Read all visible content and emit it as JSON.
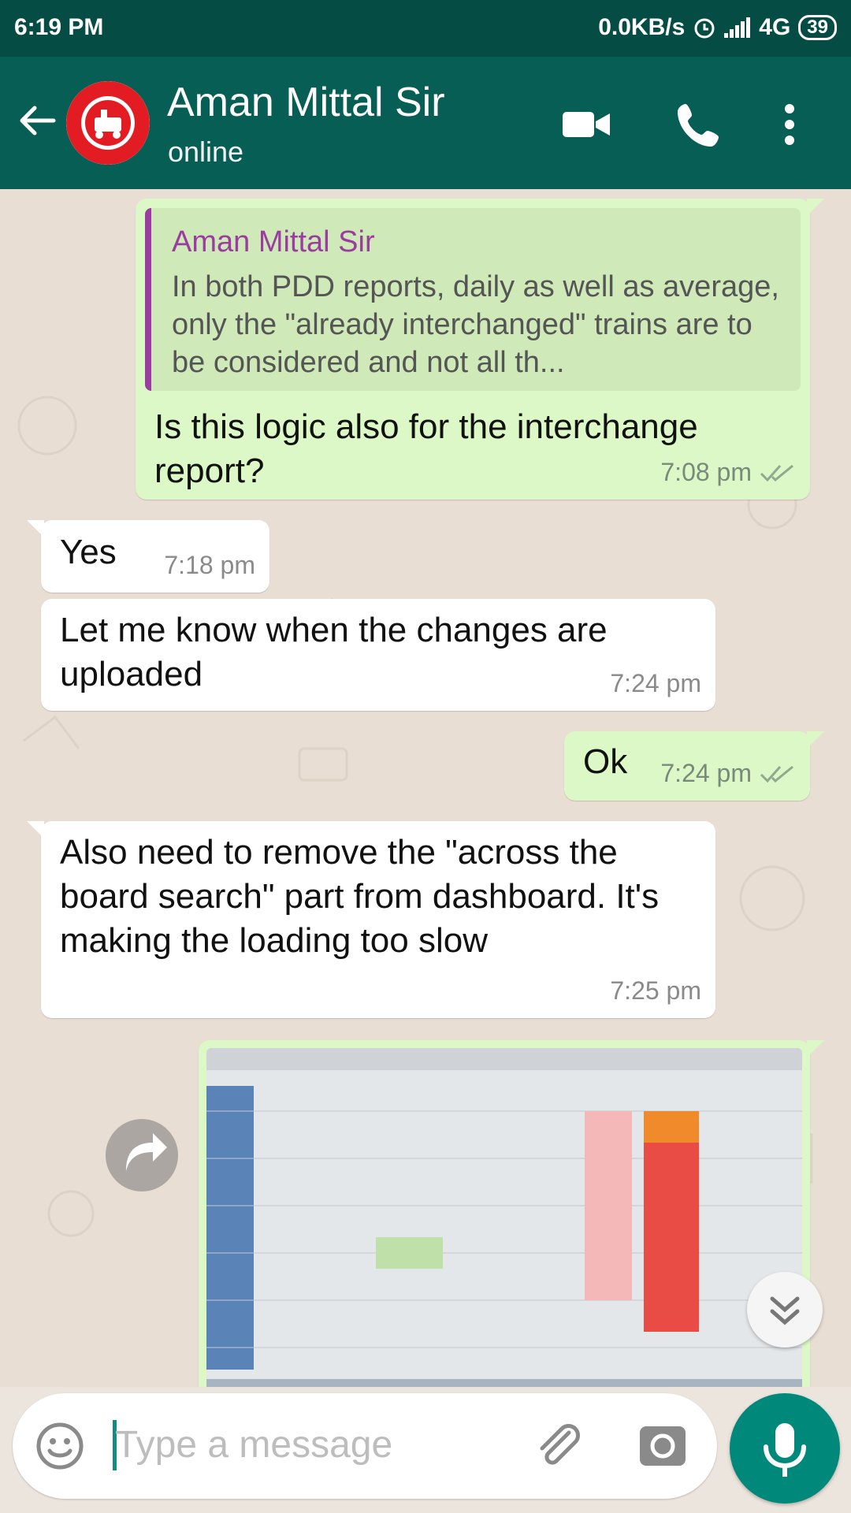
{
  "status_bar": {
    "time": "6:19 PM",
    "speed": "0.0KB/s",
    "network": "4G",
    "battery": "39"
  },
  "header": {
    "contact_name": "Aman Mittal Sir",
    "status": "online"
  },
  "messages": [
    {
      "direction": "outgoing",
      "quote_author": "Aman Mittal Sir",
      "quote_text": "In both PDD reports, daily as well as average, only the \"already interchanged\" trains are to be considered and not all th...",
      "text": "Is this logic also for the interchange report?",
      "time": "7:08 pm"
    },
    {
      "direction": "incoming",
      "text": "Yes",
      "time": "7:18 pm"
    },
    {
      "direction": "incoming",
      "text": "Let me know when the changes are uploaded",
      "time": "7:24 pm"
    },
    {
      "direction": "outgoing",
      "text": "Ok",
      "time": "7:24 pm"
    },
    {
      "direction": "incoming",
      "text": "Also need to remove the \"across the board search\" part from dashboard. It's making the loading too slow",
      "time": "7:25 pm"
    },
    {
      "direction": "outgoing",
      "type": "image"
    }
  ],
  "composer": {
    "placeholder": "Type a message"
  },
  "colors": {
    "header": "#075e54",
    "status_bar": "#054d44",
    "outgoing": "#dcf8c6",
    "incoming": "#ffffff",
    "accent": "#00897b"
  },
  "icons": [
    "back-arrow-icon",
    "video-call-icon",
    "phone-icon",
    "more-vert-icon",
    "emoji-icon",
    "attach-icon",
    "camera-icon",
    "mic-icon",
    "forward-icon",
    "scroll-down-icon",
    "read-ticks-icon"
  ]
}
